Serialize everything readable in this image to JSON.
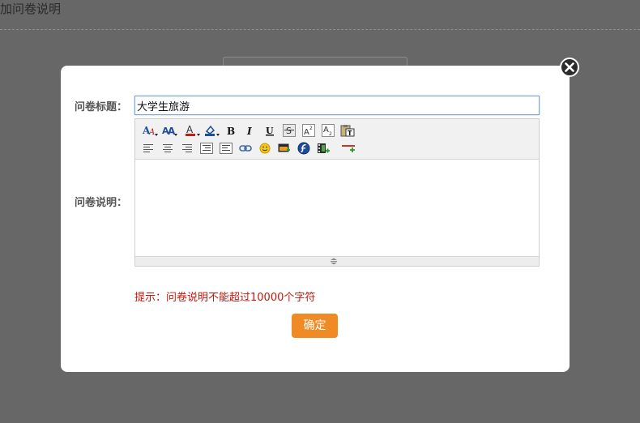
{
  "background": {
    "title": "加问卷说明"
  },
  "modal": {
    "title_label": "问卷标题：",
    "title_value": "大学生旅游",
    "desc_label": "问卷说明：",
    "hint": "提示：问卷说明不能超过10000个字符",
    "confirm_label": "确定",
    "close_icon": "close-icon"
  },
  "toolbar": {
    "row1": [
      {
        "name": "font-family-icon"
      },
      {
        "name": "font-size-icon"
      },
      {
        "name": "font-color-icon"
      },
      {
        "name": "background-color-icon"
      },
      {
        "name": "bold-icon"
      },
      {
        "name": "italic-icon"
      },
      {
        "name": "underline-icon"
      },
      {
        "name": "strikethrough-icon"
      },
      {
        "name": "superscript-icon"
      },
      {
        "name": "subscript-icon"
      },
      {
        "name": "paste-text-icon"
      }
    ],
    "row2": [
      {
        "name": "align-left-icon"
      },
      {
        "name": "align-center-icon"
      },
      {
        "name": "align-right-icon"
      },
      {
        "name": "indent-icon"
      },
      {
        "name": "outdent-icon"
      },
      {
        "name": "link-icon"
      },
      {
        "name": "emoticon-icon"
      },
      {
        "name": "insert-image-icon"
      },
      {
        "name": "insert-flash-icon"
      },
      {
        "name": "insert-media-icon"
      },
      {
        "name": "horizontal-rule-icon"
      }
    ]
  },
  "colors": {
    "accent": "#f08a24",
    "hint": "#c4170c",
    "overlay": "#676767"
  }
}
